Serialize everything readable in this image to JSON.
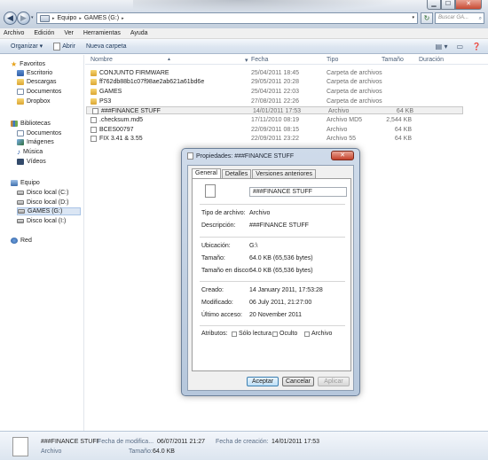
{
  "window": {
    "controls": {
      "minimize": "▁",
      "maximize": "☐",
      "close": "✕"
    },
    "nav": {
      "back": "◀",
      "forward": "▶",
      "dropdown": "▾"
    },
    "address": {
      "segments": [
        "Equipo",
        "GAMES (G:)"
      ],
      "separator": "▸",
      "dropdown": "▾"
    },
    "refresh_glyph": "↻",
    "search_placeholder": "Buscar GA...",
    "search_glyph": "⌕"
  },
  "menu": [
    "Archivo",
    "Edición",
    "Ver",
    "Herramientas",
    "Ayuda"
  ],
  "commands": {
    "organize": "Organizar ▾",
    "open": "Abrir",
    "new_folder": "Nueva carpeta",
    "view_glyph": "▤ ▾",
    "pane_glyph": "▭",
    "help_glyph": "❓"
  },
  "navpane": {
    "favorites": "Favoritos",
    "favorites_items": [
      "Escritorio",
      "Descargas",
      "Documentos",
      "Dropbox"
    ],
    "libraries": "Bibliotecas",
    "libraries_items": [
      "Documentos",
      "Imágenes",
      "Música",
      "Vídeos"
    ],
    "computer": "Equipo",
    "computer_items": [
      "Disco local (C:)",
      "Disco local (D:)",
      "GAMES (G:)",
      "Disco local (I:)"
    ],
    "network": "Red"
  },
  "columns": {
    "name": "Nombre",
    "date": "Fecha",
    "type": "Tipo",
    "size": "Tamaño",
    "duration": "Duración",
    "sort_glyph": "▲",
    "date_glyph": "▾"
  },
  "files": [
    {
      "name": "CONJUNTO FIRMWARE",
      "date": "25/04/2011 18:45",
      "type": "Carpeta de archivos",
      "size": "",
      "kind": "folder"
    },
    {
      "name": "ff762db88b1c07f98ae2ab621a61bd6e",
      "date": "29/05/2011 20:28",
      "type": "Carpeta de archivos",
      "size": "",
      "kind": "folder"
    },
    {
      "name": "GAMES",
      "date": "25/04/2011 22:03",
      "type": "Carpeta de archivos",
      "size": "",
      "kind": "folder"
    },
    {
      "name": "PS3",
      "date": "27/08/2011 22:26",
      "type": "Carpeta de archivos",
      "size": "",
      "kind": "folder"
    },
    {
      "name": "###FINANCE STUFF",
      "date": "14/01/2011 17:53",
      "type": "Archivo",
      "size": "64 KB",
      "kind": "file"
    },
    {
      "name": ".checksum.md5",
      "date": "17/11/2010 08:19",
      "type": "Archivo MD5",
      "size": "2,544 KB",
      "kind": "file"
    },
    {
      "name": "BCES00797",
      "date": "22/09/2011 08:15",
      "type": "Archivo",
      "size": "64 KB",
      "kind": "file"
    },
    {
      "name": "FIX 3.41 & 3.55",
      "date": "22/09/2011 23:22",
      "type": "Archivo 55",
      "size": "64 KB",
      "kind": "file"
    }
  ],
  "details_pane": {
    "name": "###FINANCE STUFF",
    "kind": "Archivo",
    "modified_label": "Fecha de modifica...",
    "modified_value": "06/07/2011 21:27",
    "size_label": "Tamaño:",
    "size_value": "64.0 KB",
    "created_label": "Fecha de creación:",
    "created_value": "14/01/2011 17:53"
  },
  "dialog": {
    "title": "Propiedades: ###FINANCE STUFF",
    "close": "✕",
    "tabs": [
      "General",
      "Detalles",
      "Versiones anteriores"
    ],
    "file_name": "###FINANCE STUFF",
    "type_label": "Tipo de archivo:",
    "type_value": "Archivo",
    "desc_label": "Descripción:",
    "desc_value": "###FINANCE STUFF",
    "location_label": "Ubicación:",
    "location_value": "G:\\",
    "size_label": "Tamaño:",
    "size_value": "64.0 KB (65,536 bytes)",
    "disk_label": "Tamaño en disco:",
    "disk_value": "64.0 KB (65,536 bytes)",
    "created_label": "Creado:",
    "created_value": "14 January 2011, 17:53:28",
    "modified_label": "Modificado:",
    "modified_value": "06 July 2011, 21:27:00",
    "accessed_label": "Último acceso:",
    "accessed_value": "20 November 2011",
    "attributes_label": "Atributos:",
    "attr_readonly": "Sólo lectura",
    "attr_hidden": "Oculto",
    "attr_archive": "Archivo",
    "buttons": {
      "ok": "Aceptar",
      "cancel": "Cancelar",
      "apply": "Aplicar"
    }
  }
}
